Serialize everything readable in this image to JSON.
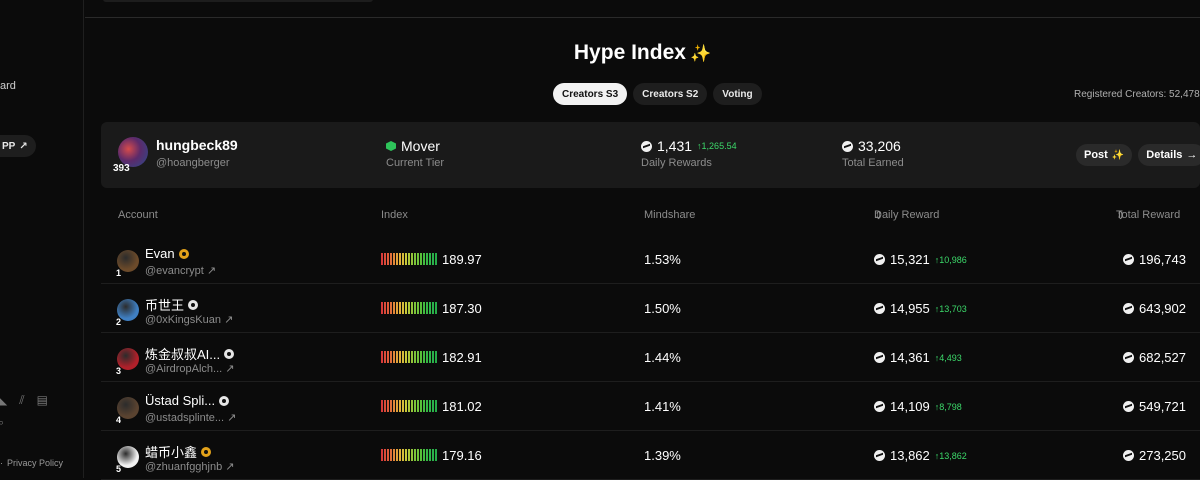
{
  "sidebar": {
    "partial_label": "ard",
    "pill_label": "PP",
    "pill_icon": "arrow-up-right-icon",
    "footer_sep": "·",
    "footer_link": "Privacy Policy"
  },
  "header": {
    "title": "Hype Index",
    "title_icon": "✨",
    "tabs": [
      {
        "label": "Creators S3",
        "active": true
      },
      {
        "label": "Creators S2",
        "active": false
      },
      {
        "label": "Voting",
        "active": false
      }
    ],
    "registered": "Registered Creators: 52,478"
  },
  "me": {
    "rank": "393",
    "name": "hungbeck89",
    "handle": "@hoangberger",
    "tier": "Mover",
    "tier_label": "Current Tier",
    "daily": "1,431",
    "daily_delta": "1,265.54",
    "daily_label": "Daily Rewards",
    "total": "33,206",
    "total_label": "Total Earned",
    "post_label": "Post",
    "details_label": "Details"
  },
  "table": {
    "headers": {
      "account": "Account",
      "index": "Index",
      "mindshare": "Mindshare",
      "daily": "Daily Reward",
      "total": "Total Reward",
      "sort_icon": "⇕"
    },
    "rows": [
      {
        "rank": "1",
        "name": "Evan",
        "handle": "@evancrypt",
        "index": "189.97",
        "mindshare": "1.53%",
        "daily": "15,321",
        "delta": "10,986",
        "total": "196,743",
        "badge": "gold",
        "avatar": "#6b4a2a"
      },
      {
        "rank": "2",
        "name": "币世王",
        "handle": "@0xKingsKuan",
        "index": "187.30",
        "mindshare": "1.50%",
        "daily": "14,955",
        "delta": "13,703",
        "total": "643,902",
        "badge": "white",
        "avatar": "#3f7fc2"
      },
      {
        "rank": "3",
        "name": "炼金叔叔AI...",
        "handle": "@AirdropAlch...",
        "index": "182.91",
        "mindshare": "1.44%",
        "daily": "14,361",
        "delta": "4,493",
        "total": "682,527",
        "badge": "white",
        "avatar": "#b0202a"
      },
      {
        "rank": "4",
        "name": "Üstad Spli...",
        "handle": "@ustadsplinte...",
        "index": "181.02",
        "mindshare": "1.41%",
        "daily": "14,109",
        "delta": "8,798",
        "total": "549,721",
        "badge": "white",
        "avatar": "#5a4330"
      },
      {
        "rank": "5",
        "name": "蜡币小鑫",
        "handle": "@zhuanfgghjnb",
        "index": "179.16",
        "mindshare": "1.39%",
        "daily": "13,862",
        "delta": "13,862",
        "total": "273,250",
        "badge": "gold",
        "avatar": "#f2f2f2"
      }
    ]
  },
  "colors": {
    "accent_green": "#3cd96a",
    "sparkle": "#b48cf2",
    "bar_gradient": [
      "#d83a3a",
      "#e07a3a",
      "#e3b23a",
      "#c8c83a",
      "#6fc43a",
      "#2fb84a"
    ]
  }
}
